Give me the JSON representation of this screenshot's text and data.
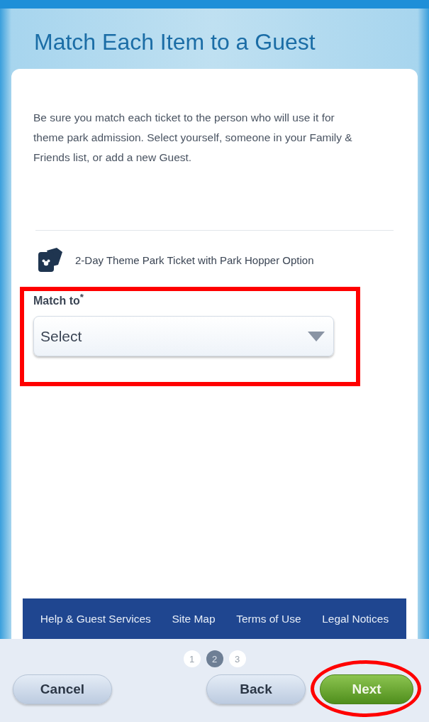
{
  "title": "Match Each Item to a Guest",
  "intro": "Be sure you match each ticket to the person who will use it for theme park admission. Select yourself, someone in your Family & Friends list, or add a new Guest.",
  "item": {
    "name": "2-Day Theme Park Ticket with Park Hopper Option"
  },
  "match_field": {
    "label": "Match to$^{*}$",
    "placeholder": "Select"
  },
  "footer_links": [
    "Help & Guest Services",
    "Site Map",
    "Terms of Use",
    "Legal Notices"
  ],
  "steps": [
    {
      "label": "1",
      "selected": false
    },
    {
      "label": "2",
      "selected": true
    },
    {
      "label": "3",
      "selected": false
    }
  ],
  "buttons": [
    {
      "label": "Cancel",
      "kind": "secondary"
    },
    {
      "label": "Back",
      "kind": "secondary"
    },
    {
      "label": "Next",
      "kind": "primary"
    }
  ],
  "annotations": [
    {
      "kind": "box"
    },
    {
      "kind": "ellipse"
    }
  ]
}
